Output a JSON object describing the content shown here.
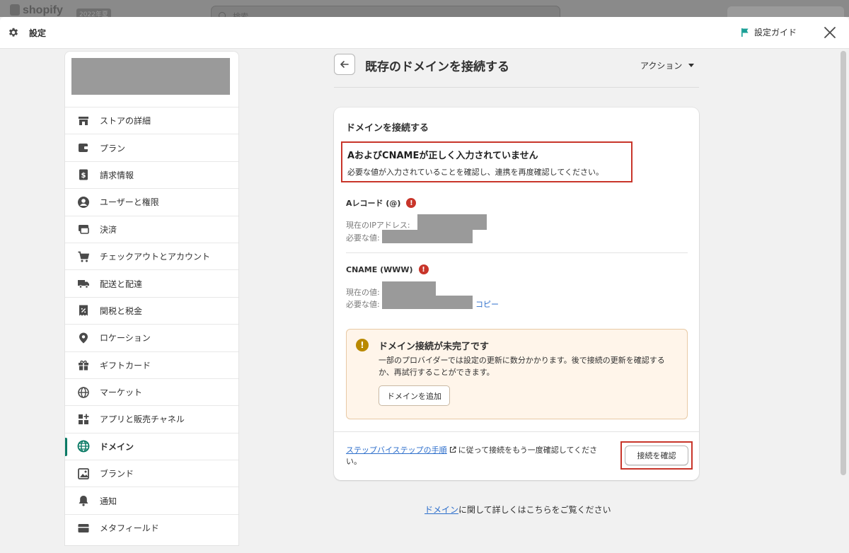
{
  "backdrop": {
    "logo": "shopify",
    "year_badge": "2022年夏",
    "search_placeholder": "検索"
  },
  "header": {
    "title": "設定",
    "guide_label": "設定ガイド"
  },
  "sidebar": {
    "items": [
      {
        "label": "ストアの詳細",
        "icon": "store-icon"
      },
      {
        "label": "プラン",
        "icon": "plan-icon"
      },
      {
        "label": "請求情報",
        "icon": "billing-icon"
      },
      {
        "label": "ユーザーと権限",
        "icon": "user-icon"
      },
      {
        "label": "決済",
        "icon": "payment-icon"
      },
      {
        "label": "チェックアウトとアカウント",
        "icon": "cart-icon"
      },
      {
        "label": "配送と配達",
        "icon": "truck-icon"
      },
      {
        "label": "関税と税金",
        "icon": "tax-icon"
      },
      {
        "label": "ロケーション",
        "icon": "location-icon"
      },
      {
        "label": "ギフトカード",
        "icon": "gift-icon"
      },
      {
        "label": "マーケット",
        "icon": "globe-icon"
      },
      {
        "label": "アプリと販売チャネル",
        "icon": "apps-icon"
      },
      {
        "label": "ドメイン",
        "icon": "domain-globe-icon",
        "active": true
      },
      {
        "label": "ブランド",
        "icon": "brand-icon"
      },
      {
        "label": "通知",
        "icon": "bell-icon"
      },
      {
        "label": "メタフィールド",
        "icon": "metafield-icon"
      }
    ]
  },
  "page": {
    "title": "既存のドメインを接続する",
    "actions_label": "アクション"
  },
  "card": {
    "title": "ドメインを接続する",
    "error_title": "AおよびCNAMEが正しく入力されていません",
    "error_desc": "必要な値が入力されていることを確認し、連携を再度確認してください。",
    "a_record": {
      "heading": "Aレコード (@)",
      "current_label": "現在のIPアドレス:",
      "required_label": "必要な値:"
    },
    "cname": {
      "heading": "CNAME (WWW)",
      "current_label": "現在の値:",
      "required_label": "必要な値:",
      "copy": "コピー"
    },
    "notice": {
      "title": "ドメイン接続が未完了です",
      "desc": "一部のプロバイダーでは設定の更新に数分かかります。後で接続の更新を確認するか、再試行することができます。",
      "button": "ドメインを追加"
    },
    "footer": {
      "link": "ステップバイステップの手順",
      "text": "に従って接続をもう一度確認してください。",
      "confirm_button": "接続を確認"
    }
  },
  "bottom_help": {
    "link": "ドメイン",
    "text": "に関して詳しくはこちらをご覧ください"
  },
  "colors": {
    "accent": "#0a7a65",
    "error": "#c8352a",
    "warning": "#b98900",
    "link": "#2c6ecb",
    "notice_bg": "#fff5ea",
    "guide_flag": "#1a9f96"
  }
}
